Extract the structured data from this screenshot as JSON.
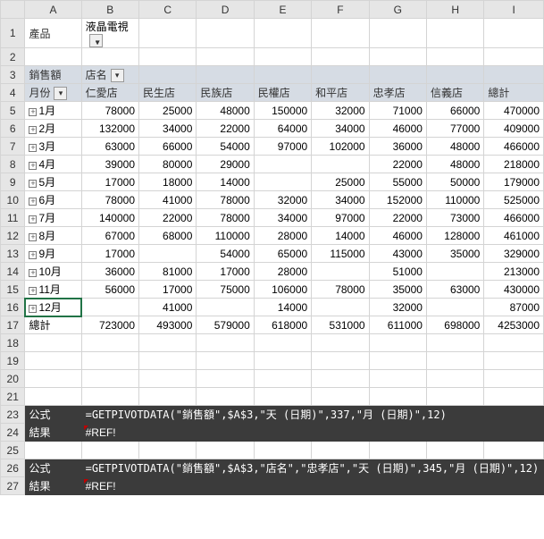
{
  "columns": [
    "A",
    "B",
    "C",
    "D",
    "E",
    "F",
    "G",
    "H",
    "I"
  ],
  "filter": {
    "label": "產品",
    "value": "液晶電視"
  },
  "labels": {
    "sales": "銷售額",
    "store": "店名",
    "month_label": "月份"
  },
  "stores": [
    "仁愛店",
    "民生店",
    "民族店",
    "民權店",
    "和平店",
    "忠孝店",
    "信義店",
    "總計"
  ],
  "rows": [
    {
      "m": "1月",
      "v": [
        "78000",
        "25000",
        "48000",
        "150000",
        "32000",
        "71000",
        "66000",
        "470000"
      ]
    },
    {
      "m": "2月",
      "v": [
        "132000",
        "34000",
        "22000",
        "64000",
        "34000",
        "46000",
        "77000",
        "409000"
      ]
    },
    {
      "m": "3月",
      "v": [
        "63000",
        "66000",
        "54000",
        "97000",
        "102000",
        "36000",
        "48000",
        "466000"
      ]
    },
    {
      "m": "4月",
      "v": [
        "39000",
        "80000",
        "29000",
        "",
        "",
        "22000",
        "48000",
        "218000"
      ]
    },
    {
      "m": "5月",
      "v": [
        "17000",
        "18000",
        "14000",
        "",
        "25000",
        "55000",
        "50000",
        "179000"
      ]
    },
    {
      "m": "6月",
      "v": [
        "78000",
        "41000",
        "78000",
        "32000",
        "34000",
        "152000",
        "110000",
        "525000"
      ]
    },
    {
      "m": "7月",
      "v": [
        "140000",
        "22000",
        "78000",
        "34000",
        "97000",
        "22000",
        "73000",
        "466000"
      ]
    },
    {
      "m": "8月",
      "v": [
        "67000",
        "68000",
        "110000",
        "28000",
        "14000",
        "46000",
        "128000",
        "461000"
      ]
    },
    {
      "m": "9月",
      "v": [
        "17000",
        "",
        "54000",
        "65000",
        "115000",
        "43000",
        "35000",
        "329000"
      ]
    },
    {
      "m": "10月",
      "v": [
        "36000",
        "81000",
        "17000",
        "28000",
        "",
        "51000",
        "",
        "213000"
      ]
    },
    {
      "m": "11月",
      "v": [
        "56000",
        "17000",
        "75000",
        "106000",
        "78000",
        "35000",
        "63000",
        "430000"
      ]
    },
    {
      "m": "12月",
      "v": [
        "",
        "41000",
        "",
        "14000",
        "",
        "32000",
        "",
        "87000"
      ]
    }
  ],
  "grand": {
    "label": "總計",
    "v": [
      "723000",
      "493000",
      "579000",
      "618000",
      "531000",
      "611000",
      "698000",
      "4253000"
    ]
  },
  "formula_label": "公式",
  "result_label": "結果",
  "f1": "=GETPIVOTDATA(\"銷售額\",$A$3,\"天 (日期)\",337,\"月 (日期)\",12)",
  "r1": "#REF!",
  "f2": "=GETPIVOTDATA(\"銷售額\",$A$3,\"店名\",\"忠孝店\",\"天 (日期)\",345,\"月 (日期)\",12)",
  "r2": "#REF!",
  "chart_data": {
    "type": "table",
    "title": "銷售額 by 店名 and 月份 (產品=液晶電視)",
    "columns": [
      "仁愛店",
      "民生店",
      "民族店",
      "民權店",
      "和平店",
      "忠孝店",
      "信義店",
      "總計"
    ],
    "rows": [
      "1月",
      "2月",
      "3月",
      "4月",
      "5月",
      "6月",
      "7月",
      "8月",
      "9月",
      "10月",
      "11月",
      "12月",
      "總計"
    ],
    "values": [
      [
        78000,
        25000,
        48000,
        150000,
        32000,
        71000,
        66000,
        470000
      ],
      [
        132000,
        34000,
        22000,
        64000,
        34000,
        46000,
        77000,
        409000
      ],
      [
        63000,
        66000,
        54000,
        97000,
        102000,
        36000,
        48000,
        466000
      ],
      [
        39000,
        80000,
        29000,
        null,
        null,
        22000,
        48000,
        218000
      ],
      [
        17000,
        18000,
        14000,
        null,
        25000,
        55000,
        50000,
        179000
      ],
      [
        78000,
        41000,
        78000,
        32000,
        34000,
        152000,
        110000,
        525000
      ],
      [
        140000,
        22000,
        78000,
        34000,
        97000,
        22000,
        73000,
        466000
      ],
      [
        67000,
        68000,
        110000,
        28000,
        14000,
        46000,
        128000,
        461000
      ],
      [
        17000,
        null,
        54000,
        65000,
        115000,
        43000,
        35000,
        329000
      ],
      [
        36000,
        81000,
        17000,
        28000,
        null,
        51000,
        null,
        213000
      ],
      [
        56000,
        17000,
        75000,
        106000,
        78000,
        35000,
        63000,
        430000
      ],
      [
        null,
        41000,
        null,
        14000,
        null,
        32000,
        null,
        87000
      ],
      [
        723000,
        493000,
        579000,
        618000,
        531000,
        611000,
        698000,
        4253000
      ]
    ]
  }
}
